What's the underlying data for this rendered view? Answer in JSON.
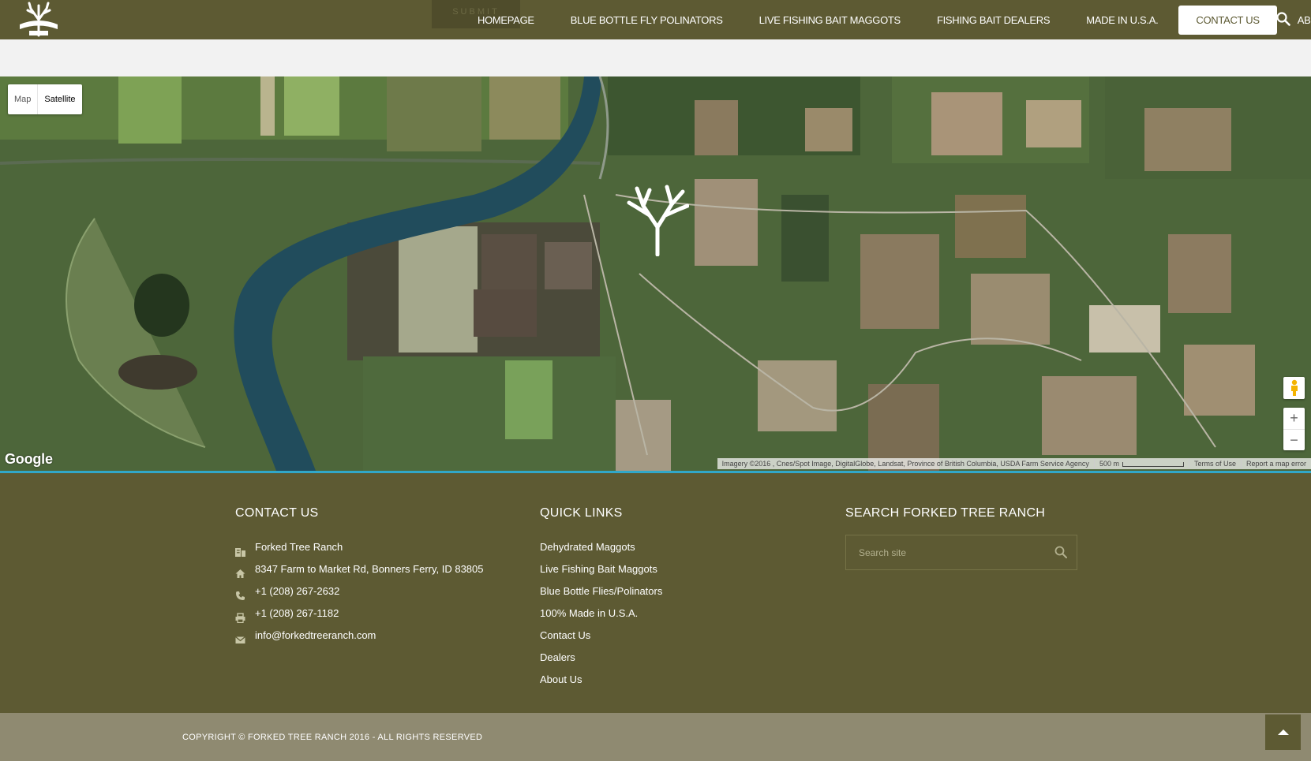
{
  "brand": {
    "logo_icon": "forked-tree-logo",
    "colors": {
      "header": "#5d5a33",
      "footer": "#5d5a33",
      "bottom_bar": "#8f8a71",
      "accent_line": "#30a7c9"
    }
  },
  "header": {
    "ghost_button": "SUBMIT",
    "nav": [
      {
        "label": "HOMEPAGE",
        "active": false
      },
      {
        "label": "BLUE BOTTLE FLY POLINATORS",
        "active": false
      },
      {
        "label": "LIVE FISHING BAIT MAGGOTS",
        "active": false
      },
      {
        "label": "FISHING BAIT DEALERS",
        "active": false
      },
      {
        "label": "MADE IN U.S.A.",
        "active": false
      },
      {
        "label": "CONTACT US",
        "active": true
      },
      {
        "label": "ABOUT US",
        "active": false
      }
    ],
    "search_icon": "search-icon"
  },
  "map": {
    "type_buttons": {
      "map": "Map",
      "satellite": "Satellite",
      "selected": "Satellite"
    },
    "marker_icon": "forked-tree-marker",
    "google_logo": "Google",
    "attribution": "Imagery ©2016 , Cnes/Spot Image, DigitalGlobe, Landsat, Province of British Columbia, USDA Farm Service Agency",
    "scale": "500 m",
    "terms": "Terms of Use",
    "report": "Report a map error",
    "zoom_in": "+",
    "zoom_out": "−"
  },
  "footer": {
    "contact": {
      "title": "CONTACT US",
      "name": "Forked Tree Ranch",
      "address": "8347 Farm to Market Rd, Bonners Ferry, ID 83805",
      "phone": "+1 (208) 267-2632",
      "fax": "+1 (208) 267-1182",
      "email": "info@forkedtreeranch.com"
    },
    "quick_links": {
      "title": "QUICK LINKS",
      "items": [
        "Dehydrated Maggots",
        "Live Fishing Bait Maggots",
        "Blue Bottle Flies/Polinators",
        "100% Made in U.S.A.",
        "Contact Us",
        "Dealers",
        "About Us"
      ]
    },
    "search": {
      "title": "SEARCH FORKED TREE RANCH",
      "placeholder": "Search site"
    }
  },
  "bottom": {
    "copyright": "COPYRIGHT © FORKED TREE RANCH 2016 - ALL RIGHTS RESERVED",
    "to_top_icon": "arrow-up-icon"
  }
}
